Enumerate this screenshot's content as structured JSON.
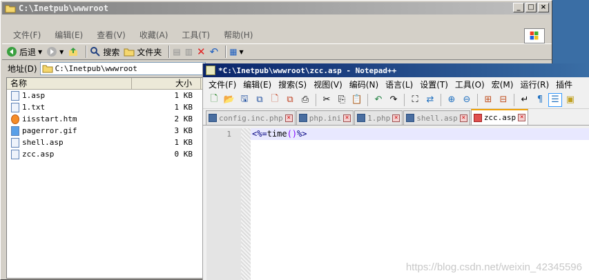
{
  "explorer": {
    "title": "C:\\Inetpub\\wwwroot",
    "window_buttons": [
      "_",
      "□",
      "×"
    ],
    "menu": [
      "文件(F)",
      "编辑(E)",
      "查看(V)",
      "收藏(A)",
      "工具(T)",
      "帮助(H)"
    ],
    "toolbar": {
      "back": "后退",
      "search": "搜索",
      "folders": "文件夹"
    },
    "address_label": "地址(D)",
    "address_value": "C:\\Inetpub\\wwwroot",
    "columns": {
      "name": "名称",
      "size": "大小"
    },
    "files": [
      {
        "name": "1.asp",
        "size": "1 KB",
        "icon": "asp-file-icon"
      },
      {
        "name": "1.txt",
        "size": "1 KB",
        "icon": "txt-file-icon"
      },
      {
        "name": "iisstart.htm",
        "size": "2 KB",
        "icon": "htm-file-icon"
      },
      {
        "name": "pagerror.gif",
        "size": "3 KB",
        "icon": "gif-file-icon"
      },
      {
        "name": "shell.asp",
        "size": "1 KB",
        "icon": "asp-file-icon"
      },
      {
        "name": "zcc.asp",
        "size": "0 KB",
        "icon": "asp-file-icon"
      }
    ]
  },
  "notepad": {
    "title": "*C:\\Inetpub\\wwwroot\\zcc.asp - Notepad++",
    "menu": [
      "文件(F)",
      "编辑(E)",
      "搜索(S)",
      "视图(V)",
      "编码(N)",
      "语言(L)",
      "设置(T)",
      "工具(O)",
      "宏(M)",
      "运行(R)",
      "插件"
    ],
    "tabs": [
      {
        "label": "config.inc.php",
        "active": false
      },
      {
        "label": "php.ini",
        "active": false
      },
      {
        "label": "1.php",
        "active": false
      },
      {
        "label": "shell.asp",
        "active": false
      },
      {
        "label": "zcc.asp",
        "active": true
      }
    ],
    "line_number": "1",
    "code": {
      "open": "<%=",
      "fn": "time",
      "parens": "()",
      "close": "%>"
    }
  },
  "watermark": "https://blog.csdn.net/weixin_42345596",
  "colors": {
    "active_title": "#0a246a",
    "inactive_title": "#808080",
    "tab_accent": "#f0a000"
  }
}
